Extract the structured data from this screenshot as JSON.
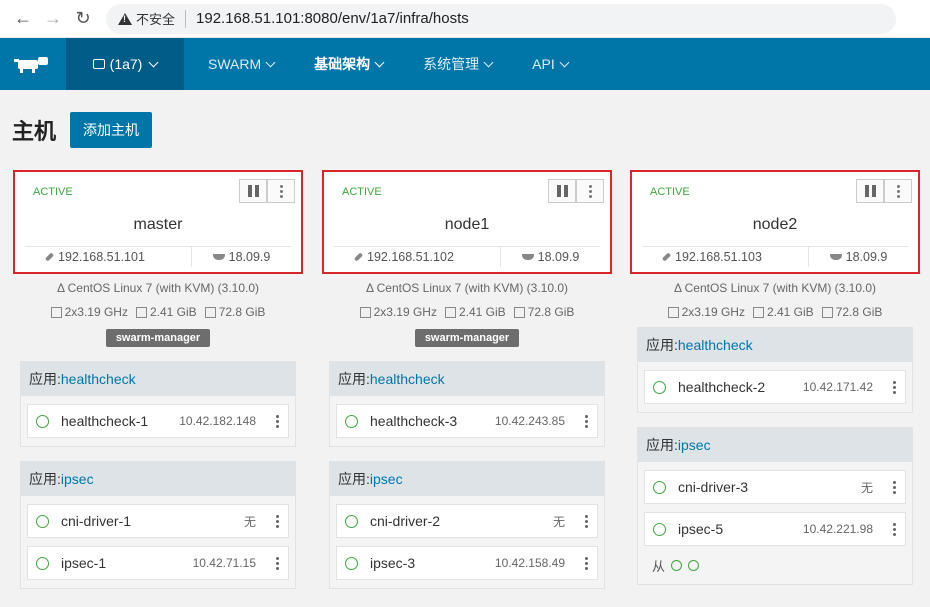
{
  "browser": {
    "security_label": "不安全",
    "url": "192.168.51.101:8080/env/1a7/infra/hosts"
  },
  "nav": {
    "env_label": "(1a7)",
    "menu": [
      "SWARM",
      "基础架构",
      "系统管理",
      "API"
    ]
  },
  "page": {
    "title": "主机",
    "add_host_label": "添加主机"
  },
  "hosts": [
    {
      "state": "ACTIVE",
      "name": "master",
      "ip": "192.168.51.101",
      "docker": "18.09.9",
      "os": "CentOS Linux 7 (with KVM) (3.10.0)",
      "cpu": "2x3.19 GHz",
      "mem": "2.41 GiB",
      "disk": "72.8 GiB",
      "label": "swarm-manager",
      "stacks": [
        {
          "prefix": "应用:",
          "name": "healthcheck",
          "services": [
            {
              "name": "healthcheck-1",
              "ip": "10.42.182.148"
            }
          ]
        },
        {
          "prefix": "应用:",
          "name": "ipsec",
          "services": [
            {
              "name": "cni-driver-1",
              "ip": "无"
            },
            {
              "name": "ipsec-1",
              "ip": "10.42.71.15"
            }
          ]
        }
      ]
    },
    {
      "state": "ACTIVE",
      "name": "node1",
      "ip": "192.168.51.102",
      "docker": "18.09.9",
      "os": "CentOS Linux 7 (with KVM) (3.10.0)",
      "cpu": "2x3.19 GHz",
      "mem": "2.41 GiB",
      "disk": "72.8 GiB",
      "label": "swarm-manager",
      "stacks": [
        {
          "prefix": "应用:",
          "name": "healthcheck",
          "services": [
            {
              "name": "healthcheck-3",
              "ip": "10.42.243.85"
            }
          ]
        },
        {
          "prefix": "应用:",
          "name": "ipsec",
          "services": [
            {
              "name": "cni-driver-2",
              "ip": "无"
            },
            {
              "name": "ipsec-3",
              "ip": "10.42.158.49"
            }
          ]
        }
      ]
    },
    {
      "state": "ACTIVE",
      "name": "node2",
      "ip": "192.168.51.103",
      "docker": "18.09.9",
      "os": "CentOS Linux 7 (with KVM) (3.10.0)",
      "cpu": "2x3.19 GHz",
      "mem": "2.41 GiB",
      "disk": "72.8 GiB",
      "label": "",
      "stacks": [
        {
          "prefix": "应用:",
          "name": "healthcheck",
          "services": [
            {
              "name": "healthcheck-2",
              "ip": "10.42.171.42"
            }
          ]
        },
        {
          "prefix": "应用:",
          "name": "ipsec",
          "services": [
            {
              "name": "cni-driver-3",
              "ip": "无"
            },
            {
              "name": "ipsec-5",
              "ip": "10.42.221.98"
            }
          ],
          "sidekick_label": "从"
        }
      ]
    }
  ],
  "colors": {
    "brand": "#0075a8",
    "active": "#41a541",
    "highlight": "#d9262b"
  }
}
